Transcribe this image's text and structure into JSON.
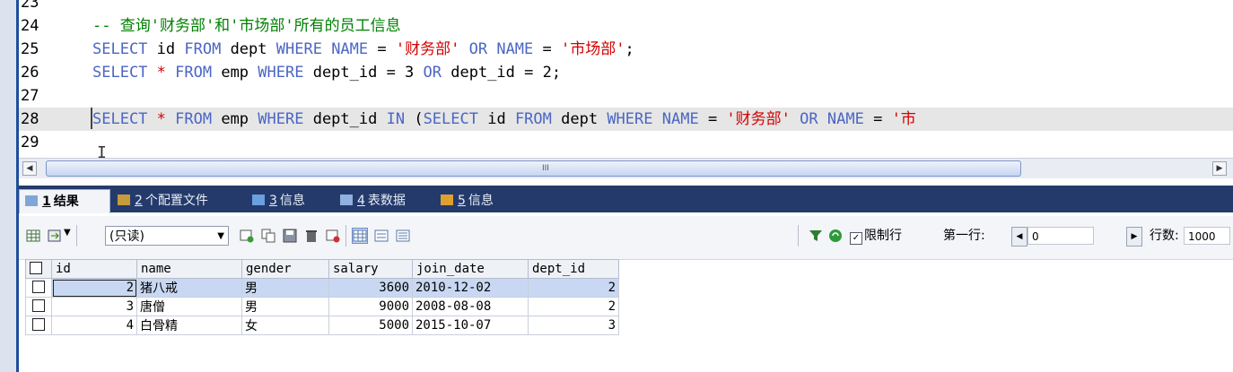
{
  "editor": {
    "lines": [
      {
        "no": "23",
        "text": ""
      },
      {
        "no": "24",
        "comment": "-- 查询'财务部'和'市场部'所有的员工信息"
      },
      {
        "no": "25",
        "parts": [
          {
            "t": "SELECT",
            "c": "kw"
          },
          {
            "t": " id ",
            "c": ""
          },
          {
            "t": "FROM",
            "c": "kw"
          },
          {
            "t": " dept ",
            "c": ""
          },
          {
            "t": "WHERE",
            "c": "kw"
          },
          {
            "t": " ",
            "c": ""
          },
          {
            "t": "NAME",
            "c": "kw"
          },
          {
            "t": " = ",
            "c": ""
          },
          {
            "t": "'财务部'",
            "c": "str"
          },
          {
            "t": " ",
            "c": ""
          },
          {
            "t": "OR",
            "c": "kw"
          },
          {
            "t": " ",
            "c": ""
          },
          {
            "t": "NAME",
            "c": "kw"
          },
          {
            "t": " = ",
            "c": ""
          },
          {
            "t": "'市场部'",
            "c": "str"
          },
          {
            "t": ";",
            "c": ""
          }
        ]
      },
      {
        "no": "26",
        "parts": [
          {
            "t": "SELECT",
            "c": "kw"
          },
          {
            "t": " * ",
            "c": "str"
          },
          {
            "t": "FROM",
            "c": "kw"
          },
          {
            "t": " emp ",
            "c": ""
          },
          {
            "t": "WHERE",
            "c": "kw"
          },
          {
            "t": " dept_id = 3 ",
            "c": ""
          },
          {
            "t": "OR",
            "c": "kw"
          },
          {
            "t": " dept_id = 2;",
            "c": ""
          }
        ]
      },
      {
        "no": "27",
        "text": ""
      },
      {
        "no": "28",
        "highlight": true,
        "parts": [
          {
            "t": "SELECT",
            "c": "kw"
          },
          {
            "t": " * ",
            "c": "str"
          },
          {
            "t": "FROM",
            "c": "kw"
          },
          {
            "t": " emp ",
            "c": ""
          },
          {
            "t": "WHERE",
            "c": "kw"
          },
          {
            "t": " dept_id ",
            "c": ""
          },
          {
            "t": "IN",
            "c": "kw"
          },
          {
            "t": " (",
            "c": ""
          },
          {
            "t": "SELECT",
            "c": "kw"
          },
          {
            "t": " id ",
            "c": ""
          },
          {
            "t": "FROM",
            "c": "kw"
          },
          {
            "t": " dept ",
            "c": ""
          },
          {
            "t": "WHERE",
            "c": "kw"
          },
          {
            "t": " ",
            "c": ""
          },
          {
            "t": "NAME",
            "c": "kw"
          },
          {
            "t": " = ",
            "c": ""
          },
          {
            "t": "'财务部'",
            "c": "str"
          },
          {
            "t": " ",
            "c": ""
          },
          {
            "t": "OR",
            "c": "kw"
          },
          {
            "t": " ",
            "c": ""
          },
          {
            "t": "NAME",
            "c": "kw"
          },
          {
            "t": " = ",
            "c": ""
          },
          {
            "t": "'市",
            "c": "str"
          }
        ]
      },
      {
        "no": "29",
        "text": ""
      }
    ],
    "scroll_grip": "III"
  },
  "tabs": [
    {
      "num": "1",
      "label": "结果",
      "icon": "result-grid-icon",
      "active": true
    },
    {
      "num": "2",
      "label": "个配置文件",
      "icon": "profile-icon",
      "active": false
    },
    {
      "num": "3",
      "label": "信息",
      "icon": "info-icon",
      "active": false
    },
    {
      "num": "4",
      "label": "表数据",
      "icon": "table-data-icon",
      "active": false
    },
    {
      "num": "5",
      "label": "信息",
      "icon": "info-color-icon",
      "active": false
    }
  ],
  "toolbar": {
    "mode_select": "(只读)",
    "limit_rows_label": "限制行",
    "limit_rows_checked": true,
    "first_row_label": "第一行:",
    "first_row_value": "0",
    "row_count_label": "行数:",
    "row_count_value": "1000"
  },
  "grid": {
    "columns": [
      "id",
      "name",
      "gender",
      "salary",
      "join_date",
      "dept_id"
    ],
    "rows": [
      [
        "2",
        "猪八戒",
        "男",
        "3600",
        "2010-12-02",
        "2"
      ],
      [
        "3",
        "唐僧",
        "男",
        "9000",
        "2008-08-08",
        "2"
      ],
      [
        "4",
        "白骨精",
        "女",
        "5000",
        "2015-10-07",
        "3"
      ]
    ]
  }
}
